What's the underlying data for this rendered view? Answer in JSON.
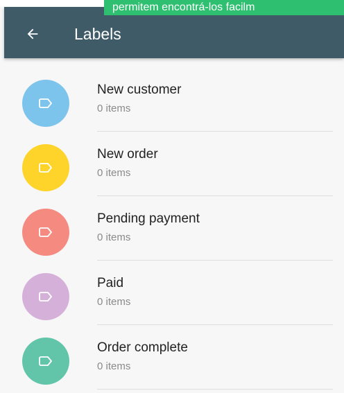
{
  "banner": {
    "text": "permitem encontrá-los facilm"
  },
  "appbar": {
    "title": "Labels",
    "color": "#3f5b67"
  },
  "labels": [
    {
      "name": "New customer",
      "count": "0 items",
      "color": "#7cc4ec"
    },
    {
      "name": "New order",
      "count": "0 items",
      "color": "#ffd42a"
    },
    {
      "name": "Pending payment",
      "count": "0 items",
      "color": "#f48a80"
    },
    {
      "name": "Paid",
      "count": "0 items",
      "color": "#d5b0d8"
    },
    {
      "name": "Order complete",
      "count": "0 items",
      "color": "#62c5aa"
    }
  ],
  "icons": {
    "back": "arrow-back-icon",
    "label": "label-tag-icon"
  }
}
